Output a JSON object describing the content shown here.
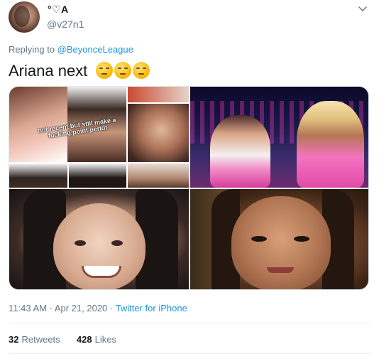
{
  "author": {
    "display_name": "°♡A",
    "handle": "@v27n1"
  },
  "reply_context": {
    "prefix": "Replying to",
    "mention": "@BeyonceLeague"
  },
  "tweet": {
    "text": "Ariana next",
    "emojis": [
      "pensive-face",
      "pensive-face",
      "pensive-face"
    ]
  },
  "media": {
    "collage_caption": "not recent but still make a fucking point peridt"
  },
  "meta": {
    "time": "11:43 AM",
    "separator": "·",
    "date": "Apr 21, 2020",
    "client": "Twitter for iPhone"
  },
  "stats": {
    "retweets_count": "32",
    "retweets_label": "Retweets",
    "likes_count": "428",
    "likes_label": "Likes"
  },
  "colors": {
    "link": "#1b95e0",
    "secondary_text": "#657786",
    "primary_text": "#14171a"
  }
}
